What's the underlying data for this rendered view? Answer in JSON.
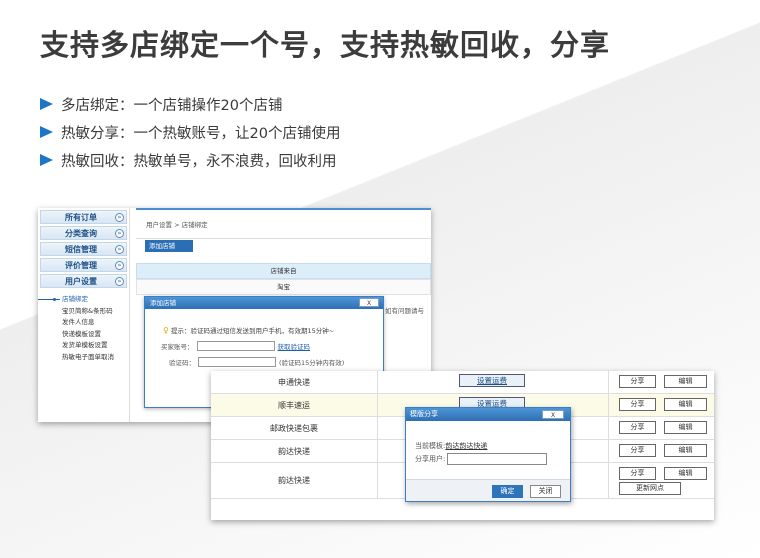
{
  "title": "支持多店绑定一个号，支持热敏回收，分享",
  "bullets": [
    "多店绑定：一个店铺操作20个店铺",
    "热敏分享：一个热敏账号，让20个店铺使用",
    "热敏回收：热敏单号，永不浪费，回收利用"
  ],
  "colors": {
    "accent": "#1e76c6",
    "dialog_header": "#2e6fb3"
  },
  "back_screen": {
    "menu": [
      {
        "label": "所有订单",
        "icon": "circle-arrow-icon"
      },
      {
        "label": "分类查询",
        "icon": "circle-arrow-icon"
      },
      {
        "label": "短信管理",
        "icon": "circle-arrow-icon"
      },
      {
        "label": "评价管理",
        "icon": "circle-arrow-icon"
      },
      {
        "label": "用户设置",
        "icon": "circle-arrow-icon"
      }
    ],
    "submenu": [
      "店铺绑定",
      "宝贝简称&条形码",
      "发件人信息",
      "快递模板设置",
      "发货单模板设置",
      "热敏电子面单取消"
    ],
    "breadcrumb": "用户设置 > 店铺绑定",
    "add_button": "添加店铺",
    "table_header": "店铺来自",
    "table_row": "淘宝",
    "notice_text": "如有问题请与",
    "dialog": {
      "title": "添加店铺",
      "close": "X",
      "tip": "提示：验证码通过短信发送到用户手机，有效期15分钟~",
      "phone_label": "买家账号：",
      "get_code_link": "获取验证码",
      "code_label": "验证码：",
      "code_hint": "(验证码15分钟内有效)"
    }
  },
  "front_screen": {
    "rows": [
      {
        "name": "申通快递",
        "setting": "设置运费",
        "actions": [
          "分享",
          "编辑"
        ]
      },
      {
        "name": "顺丰速运",
        "setting": "设置运费",
        "actions": [
          "分享",
          "编辑"
        ]
      },
      {
        "name": "邮政快递包裹",
        "setting": "",
        "actions": [
          "分享",
          "编辑"
        ]
      },
      {
        "name": "韵达快递",
        "setting": "",
        "actions": [
          "分享",
          "编辑"
        ]
      },
      {
        "name": "韵达快递",
        "setting": "",
        "actions": [
          "分享",
          "编辑",
          "更新网点"
        ]
      }
    ],
    "dialog": {
      "title": "模版分享",
      "close": "X",
      "current_label": "当前模板:",
      "current_value": "韵达韵达快递",
      "share_label": "分享用户:",
      "share_value": "",
      "ok": "确定",
      "cancel": "关闭"
    }
  }
}
